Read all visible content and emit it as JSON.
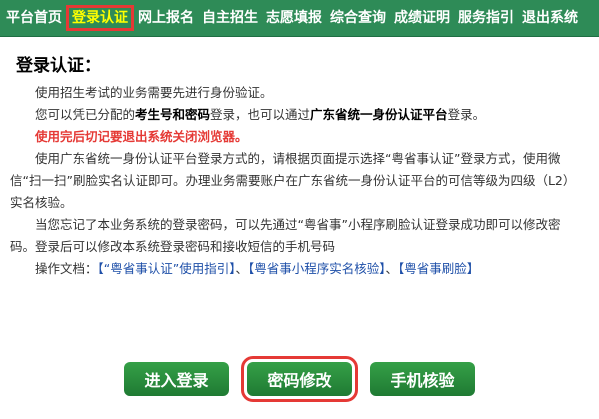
{
  "nav": {
    "items": [
      {
        "label": "平台首页"
      },
      {
        "label": "登录认证",
        "active": true
      },
      {
        "label": "网上报名"
      },
      {
        "label": "自主招生"
      },
      {
        "label": "志愿填报"
      },
      {
        "label": "综合查询"
      },
      {
        "label": "成绩证明"
      },
      {
        "label": "服务指引"
      },
      {
        "label": "退出系统"
      }
    ]
  },
  "content": {
    "title": "登录认证：",
    "p1": "使用招生考试的业务需要先进行身份验证。",
    "p2_prefix": "您可以凭已分配的",
    "p2_bold1": "考生号和密码",
    "p2_mid": "登录，也可以通过",
    "p2_bold2": "广东省统一身份认证平台",
    "p2_suffix": "登录。",
    "warning": "使用完后切记要退出系统关闭浏览器。",
    "p3": "使用广东省统一身份认证平台登录方式的，请根据页面提示选择“粤省事认证”登录方式，使用微信“扫一扫”刷脸实名认证即可。办理业务需要账户在广东省统一身份认证平台的可信等级为四级（L2）实名核验。",
    "p4": "当您忘记了本业务系统的登录密码，可以先通过“粤省事”小程序刷脸认证登录成功即可以修改密码。登录后可以修改本系统登录密码和接收短信的手机号码",
    "docs_prefix": "操作文档：",
    "doc1": "【“粤省事认证”使用指引】",
    "sep": "、",
    "doc2": "【粤省事小程序实名核验】",
    "doc3": "【粤省事刷脸】"
  },
  "actions": {
    "login": "进入登录",
    "change_password": "密码修改",
    "phone_verify": "手机核验"
  },
  "colors": {
    "nav_bg": "#2e8b57",
    "nav_active_text": "#ffff00",
    "highlight_border": "#e53935",
    "button_green": "#2a8f3d",
    "link_blue": "#1e4fa8",
    "warning_red": "#e53935"
  }
}
